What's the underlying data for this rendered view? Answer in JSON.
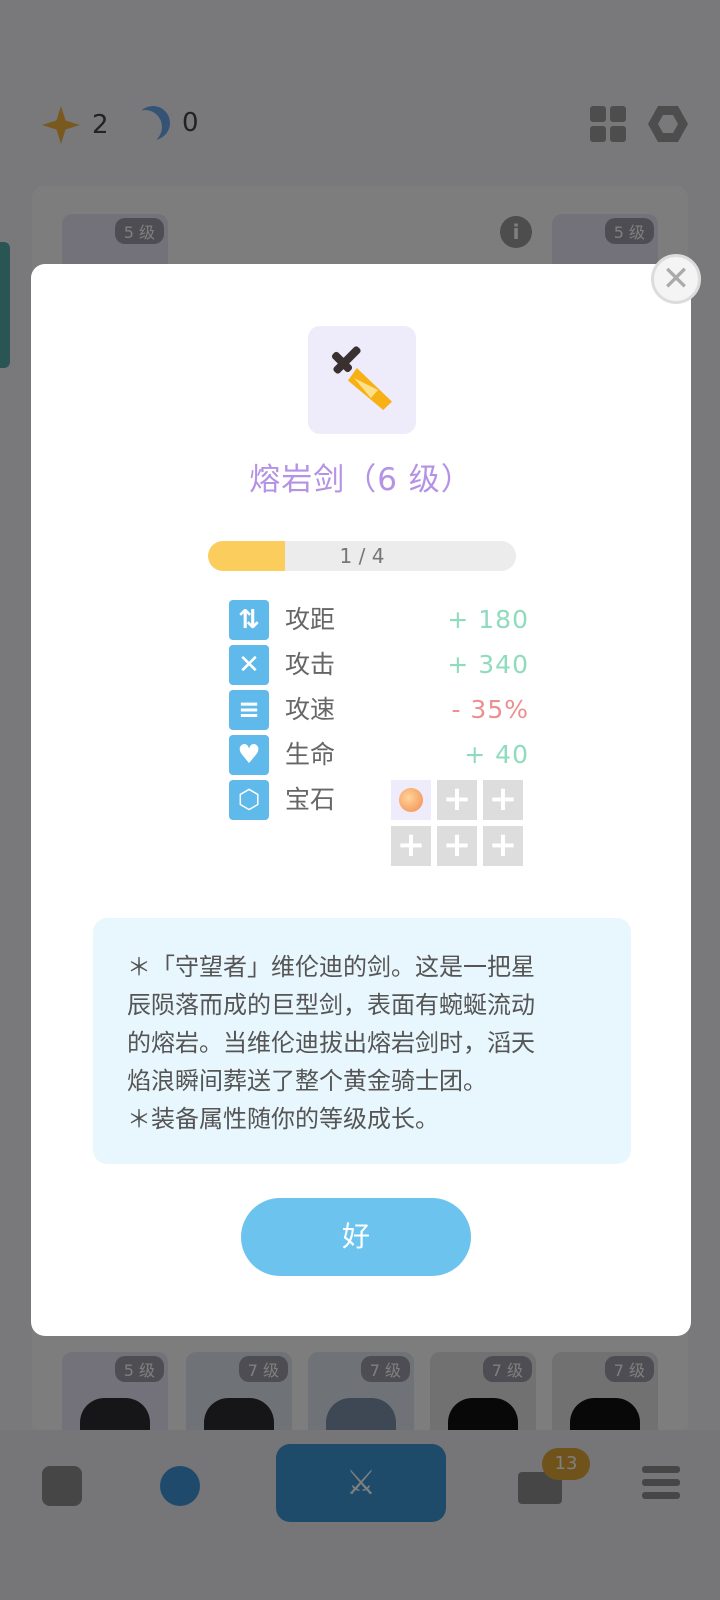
{
  "header": {
    "currency": [
      {
        "icon": "star-icon",
        "value": "2"
      },
      {
        "icon": "moon-icon",
        "value": "0"
      }
    ]
  },
  "background": {
    "top_cards": [
      {
        "level": "5 级"
      },
      {
        "level": "5 级"
      }
    ],
    "bottom_cards": [
      {
        "level": "5 级"
      },
      {
        "level": "7 级"
      },
      {
        "level": "7 级"
      },
      {
        "level": "7 级"
      },
      {
        "level": "7 级"
      }
    ],
    "info_icon": "i"
  },
  "nav": {
    "mail_badge": "13"
  },
  "modal": {
    "close": "✕",
    "item_name": "熔岩剑（6 级）",
    "progress": {
      "text": "1 / 4",
      "current": 1,
      "total": 4
    },
    "stats": [
      {
        "icon": "range-icon",
        "glyph": "⇅",
        "label": "攻距",
        "value": "+ 180",
        "tone": "pos"
      },
      {
        "icon": "attack-icon",
        "glyph": "✕",
        "label": "攻击",
        "value": "+ 340",
        "tone": "pos"
      },
      {
        "icon": "speed-icon",
        "glyph": "≡",
        "label": "攻速",
        "value": "- 35%",
        "tone": "neg"
      },
      {
        "icon": "heart-icon",
        "glyph": "♥",
        "label": "生命",
        "value": "+ 40",
        "tone": "pos"
      },
      {
        "icon": "gem-icon",
        "glyph": "⬡",
        "label": "宝石",
        "value": "",
        "tone": "pos"
      }
    ],
    "gem_slots": [
      "filled",
      "+",
      "+",
      "+",
      "+",
      "+"
    ],
    "description": [
      "＊「守望者」维伦迪的剑。这是一把星",
      "辰陨落而成的巨型剑，表面有蜿蜒流动",
      "的熔岩。当维伦迪拔出熔岩剑时，滔天",
      "焰浪瞬间葬送了整个黄金骑士团。",
      "＊装备属性随你的等级成长。"
    ],
    "ok_label": "好"
  },
  "colors": {
    "title": "#b493e4",
    "progress_fill": "#fbcd5c",
    "stat_icon": "#5fb9ea",
    "positive": "#8fdbbe",
    "negative": "#ec8f8f",
    "ok_button": "#6cc4ee",
    "description_bg": "#e8f6fd"
  }
}
